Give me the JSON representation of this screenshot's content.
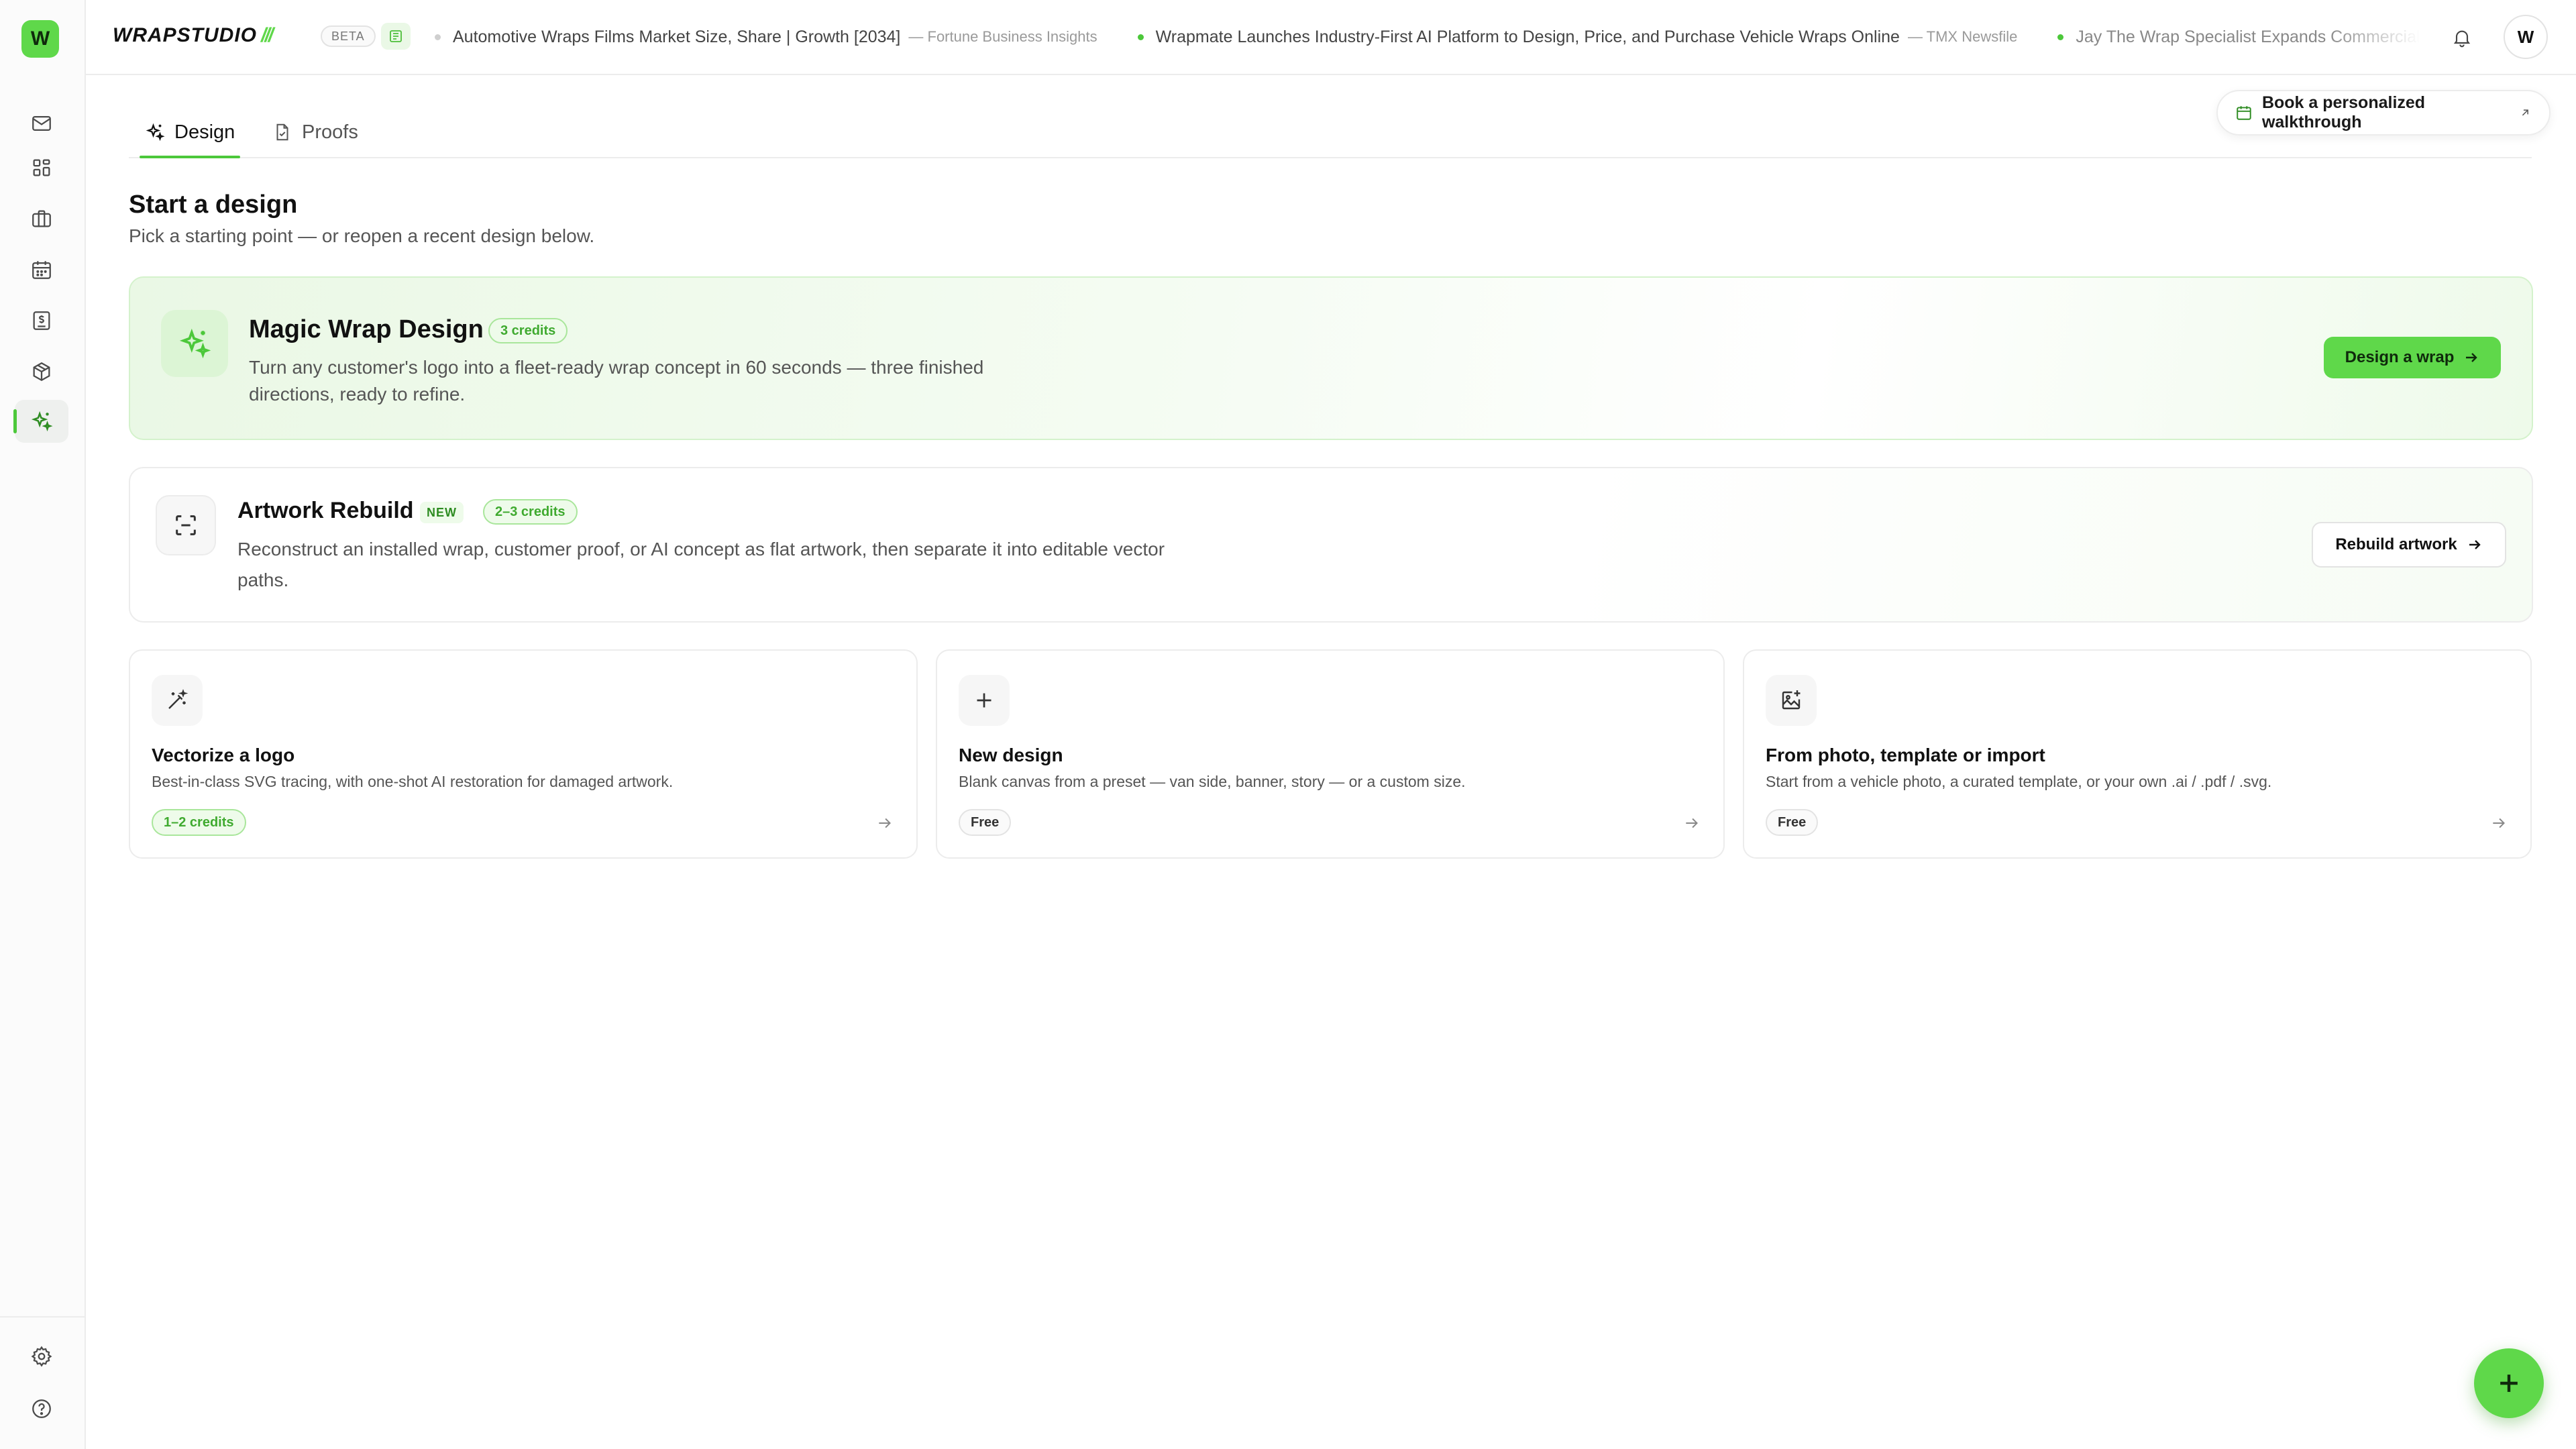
{
  "app": {
    "logo_letter": "W",
    "brand_name": "WRAPSTUDIO",
    "brand_slash": "///",
    "beta_label": "BETA",
    "avatar_letter": "W"
  },
  "ticker": [
    {
      "title": "Automotive Wraps Films Market Size, Share | Growth [2034]",
      "source": "— Fortune Business Insights"
    },
    {
      "title": "Wrapmate Launches Industry-First AI Platform to Design, Price, and Purchase Vehicle Wraps Online",
      "source": "— TMX Newsfile"
    },
    {
      "title": "Jay The Wrap Specialist Expands Commercial Vehicle W",
      "source": ""
    }
  ],
  "tabs": [
    {
      "label": "Design",
      "active": true
    },
    {
      "label": "Proofs",
      "active": false
    }
  ],
  "walkthrough_label": "Book a personalized walkthrough",
  "heading": {
    "title": "Start a design",
    "subtitle": "Pick a starting point — or reopen a recent design below."
  },
  "magic": {
    "title": "Magic Wrap Design",
    "credits": "3 credits",
    "description": "Turn any customer's logo into a fleet-ready wrap concept in 60 seconds — three finished directions, ready to refine.",
    "button": "Design a wrap"
  },
  "rebuild": {
    "title": "Artwork Rebuild",
    "new_badge": "NEW",
    "credits": "2–3 credits",
    "description": "Reconstruct an installed wrap, customer proof, or AI concept as flat artwork, then separate it into editable vector paths.",
    "button": "Rebuild artwork"
  },
  "options": [
    {
      "title": "Vectorize a logo",
      "description": "Best-in-class SVG tracing, with one-shot AI restoration for damaged artwork.",
      "badge": "1–2 credits",
      "icon": "magic-wand-icon"
    },
    {
      "title": "New design",
      "description": "Blank canvas from a preset — van side, banner, story — or a custom size.",
      "badge": "Free",
      "icon": "plus-icon"
    },
    {
      "title": "From photo, template or import",
      "description": "Start from a vehicle photo, a curated template, or your own .ai / .pdf / .svg.",
      "badge": "Free",
      "icon": "image-add-icon"
    }
  ],
  "colors": {
    "accent": "#5fd84a",
    "accent_dark": "#2e8c22",
    "border": "#ececec"
  }
}
